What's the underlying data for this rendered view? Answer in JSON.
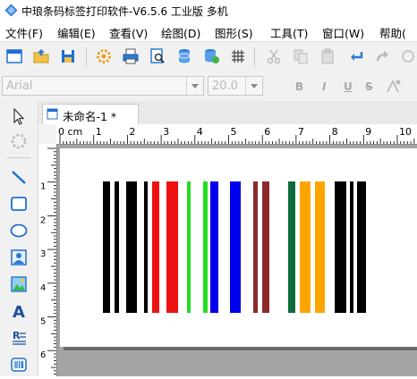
{
  "window": {
    "title": "中琅条码标签打印软件-V6.5.6 工业版 多机"
  },
  "menu": [
    "文件(F)",
    "编辑(E)",
    "查看(V)",
    "绘图(D)",
    "图形(S)",
    "工具(T)",
    "窗口(W)",
    "帮助("
  ],
  "font_toolbar": {
    "font_family": "Arial",
    "font_size": "20.0",
    "bold": "B",
    "italic": "I",
    "underline": "U",
    "strikethrough": "S"
  },
  "document": {
    "tab_label": "未命名-1 *"
  },
  "ruler": {
    "unit_label": "0 cm",
    "top_ticks": [
      "1",
      "2",
      "3",
      "4",
      "5",
      "6",
      "7",
      "8",
      "9",
      "10"
    ],
    "left_ticks": [
      "1",
      "2",
      "3",
      "4",
      "5",
      "6"
    ]
  },
  "barcode": {
    "colors": {
      "black": "#000000",
      "red": "#ee1111",
      "green": "#22dd22",
      "blue": "#0000ee",
      "maroon": "#8b2a2a",
      "dark_green": "#0d6b3a",
      "orange": "#ffa500"
    }
  },
  "colors": {
    "toolbar_bg": "#f1f1f1",
    "workspace_bg": "#a4a4a4",
    "accent_blue": "#1e6fd0"
  }
}
